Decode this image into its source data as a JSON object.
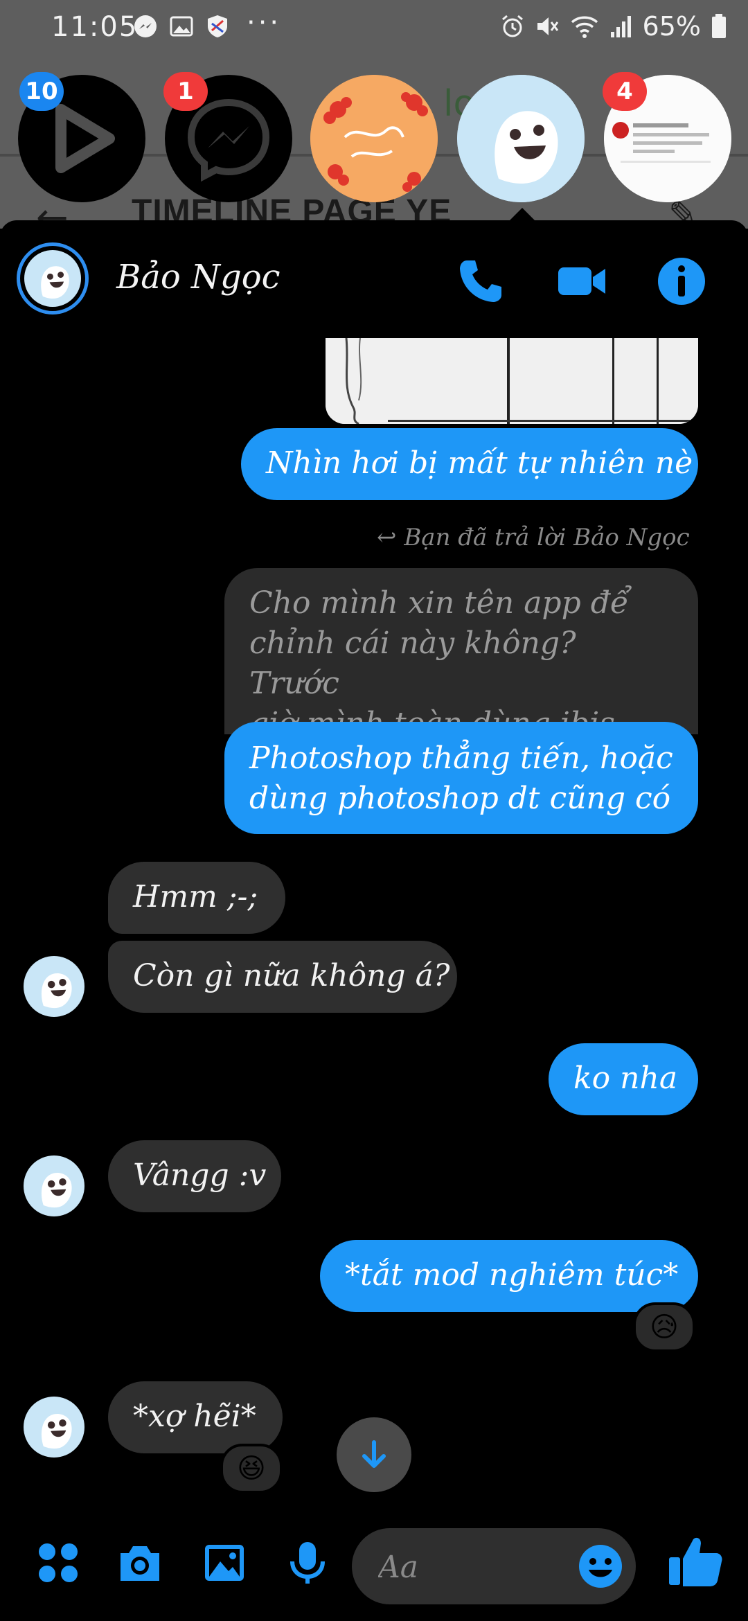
{
  "status_bar": {
    "time": "11:05",
    "battery": "65%"
  },
  "chat_heads": [
    {
      "name": "play-head",
      "badge": "10",
      "badge_color": "#1a86f0"
    },
    {
      "name": "messenger-head",
      "badge": "1",
      "badge_color": "#f03a3a"
    },
    {
      "name": "hoa-phuong-do-head",
      "badge": null
    },
    {
      "name": "bao-ngoc-head",
      "badge": null
    },
    {
      "name": "post-head",
      "badge": "4",
      "badge_color": "#f03a3a"
    }
  ],
  "background_page": {
    "title": "TIMELINE PAGE YE",
    "url_fragment": "loc  e.c"
  },
  "header": {
    "name": "Bảo Ngọc"
  },
  "messages": {
    "m1": "Nhìn hơi bị mất tự nhiên nè",
    "reply_note": "Bạn đã trả lời Bảo Ngọc",
    "quoted_line1": "Cho mình xin tên app để",
    "quoted_line2": "chỉnh cái này không? Trước",
    "quoted_line3": "giờ mình toàn dùng ibis thôi",
    "m2_line1": "Photoshop thẳng tiến, hoặc",
    "m2_line2": "dùng photoshop dt cũng có",
    "m3": "Hmm ;-;",
    "m4": "Còn gì nữa không á?",
    "m5": "ko nha",
    "m6": "Vângg :v",
    "m7": "*tắt mod nghiêm túc*",
    "m7_reaction": "😥",
    "m8": "*xợ hẽi*",
    "m8_reaction": "😆"
  },
  "composer": {
    "placeholder": "Aa"
  },
  "colors": {
    "accent": "#1e97f7",
    "incoming_bubble": "#2f2f2f",
    "background": "#000000"
  }
}
